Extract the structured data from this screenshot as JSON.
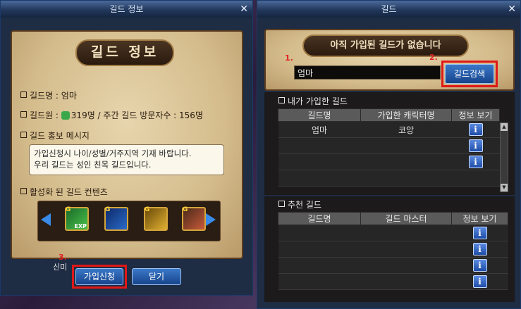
{
  "left_window": {
    "title": "길드 정보",
    "heading": "길드 정보",
    "guild_name_line": "길드명 : 엄마",
    "guild_members_prefix": "길드원 : ",
    "guild_members_rest": "319명 / 주간 길드 방문자수 : 156명",
    "promo_label": "길드 홍보 메시지",
    "promo_message": "가입신청시 나이/성별/거주지역 기재 바랍니다.\n우리 길드는 성인 친목 길드입니다.",
    "content_label": "활성화 된 길드 컨텐츠",
    "content_icons": [
      {
        "icon": "exp-boost-icon",
        "badge": "G",
        "sub": "EXP"
      },
      {
        "icon": "guild-member-icon",
        "badge": "G",
        "sub": ""
      },
      {
        "icon": "golden-statue-icon",
        "badge": "G",
        "sub": ""
      },
      {
        "icon": "shop-delivery-icon",
        "badge": "G",
        "sub": ""
      }
    ],
    "apply_button": "가입신청",
    "close_button": "닫기",
    "annotation": "3.",
    "partial_text": "신미"
  },
  "right_window": {
    "title": "길드",
    "status_banner": "아직 가입된 길드가 없습니다",
    "search_value": "엄마",
    "search_button": "길드검색",
    "annotation_1": "1.",
    "annotation_2": "2.",
    "joined_section": {
      "label": "내가 가입한 길드",
      "columns": [
        "길드명",
        "가입한 캐릭터명",
        "정보 보기"
      ],
      "rows": [
        {
          "guild": "엄마",
          "character": "코앙"
        },
        {
          "guild": "",
          "character": ""
        },
        {
          "guild": "",
          "character": ""
        },
        {
          "guild": "",
          "character": ""
        }
      ]
    },
    "recommended_section": {
      "label": "추천 길드",
      "columns": [
        "길드명",
        "길드 마스터",
        "정보 보기"
      ],
      "rows": [
        {
          "guild": "",
          "master": ""
        },
        {
          "guild": "",
          "master": ""
        },
        {
          "guild": "",
          "master": ""
        },
        {
          "guild": "",
          "master": ""
        }
      ]
    }
  },
  "colors": {
    "annotation_red": "#e01818",
    "button_blue": "#2a5fb0"
  }
}
